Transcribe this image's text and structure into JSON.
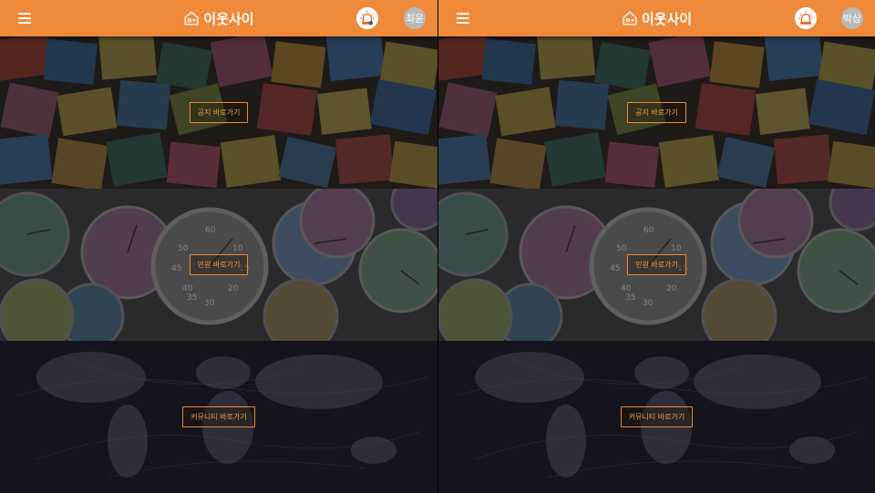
{
  "panels": [
    {
      "brand": "이웃사이",
      "avatar": "최윤",
      "sections": [
        {
          "label": "공지 바로가기"
        },
        {
          "label": "민원 바로가기"
        },
        {
          "label": "커뮤니티 바로가기"
        }
      ]
    },
    {
      "brand": "이웃사이",
      "avatar": "박상",
      "sections": [
        {
          "label": "공지 바로가기"
        },
        {
          "label": "민원 바로가기"
        },
        {
          "label": "커뮤니티 바로가기"
        }
      ]
    }
  ],
  "colors": {
    "appbar": "#ef8a3a",
    "accent": "#f09a4e"
  },
  "icons": {
    "menu": "menu-icon",
    "logo": "house-logo-icon",
    "alert": "siren-icon"
  }
}
